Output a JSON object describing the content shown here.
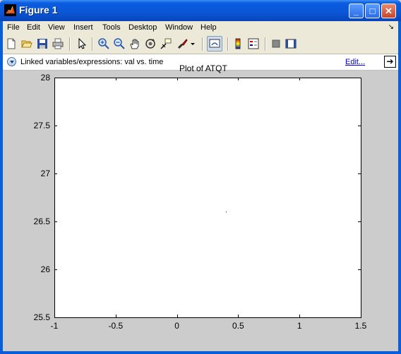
{
  "window": {
    "title": "Figure 1",
    "minimize": "_",
    "maximize": "□",
    "close": "✕"
  },
  "menu": [
    "File",
    "Edit",
    "View",
    "Insert",
    "Tools",
    "Desktop",
    "Window",
    "Help"
  ],
  "menu_corner": "↘",
  "toolbar": {
    "icons": [
      "new-figure-icon",
      "open-file-icon",
      "save-icon",
      "print-icon",
      "edit-plot-arrow-icon",
      "zoom-in-icon",
      "zoom-out-icon",
      "pan-hand-icon",
      "rotate-3d-icon",
      "data-cursor-icon",
      "brush-icon",
      "brush-dropdown-icon",
      "link-plot-icon",
      "colorbar-icon",
      "legend-icon",
      "hide-plot-tools-icon",
      "show-plot-tools-icon"
    ]
  },
  "linkbar": {
    "text": "Linked variables/expressions: val vs. time",
    "edit": "Edit...",
    "go": "➔"
  },
  "chart_data": {
    "type": "scatter",
    "title": "Plot of ATQT",
    "x": [
      0.4
    ],
    "y": [
      26.6
    ],
    "xlim": [
      -1,
      1.5
    ],
    "ylim": [
      25.5,
      28
    ],
    "xticks": [
      "-1",
      "-0.5",
      "0",
      "0.5",
      "1",
      "1.5"
    ],
    "yticks": [
      "28",
      "27.5",
      "27",
      "26.5",
      "26",
      "25.5"
    ],
    "grid": false
  }
}
